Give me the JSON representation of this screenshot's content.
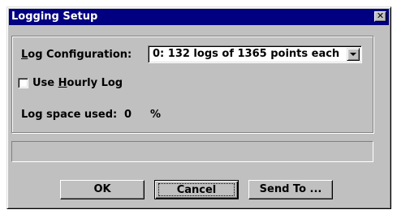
{
  "window": {
    "title": "Logging Setup",
    "close_glyph": "✕"
  },
  "config": {
    "label_prefix": "",
    "label_accel": "L",
    "label_rest": "og Configuration:",
    "select_value": "0: 132 logs of 1365 points each"
  },
  "hourly": {
    "checked": false,
    "label_prefix": "Use ",
    "label_accel": "H",
    "label_rest": "ourly Log"
  },
  "space": {
    "label": "Log space used:",
    "value": "0",
    "unit": "%"
  },
  "status": {
    "text": ""
  },
  "buttons": {
    "ok": "OK",
    "cancel": "Cancel",
    "send_to": "Send To ..."
  },
  "colors": {
    "titlebar": "#000080",
    "face": "#c0c0c0"
  }
}
